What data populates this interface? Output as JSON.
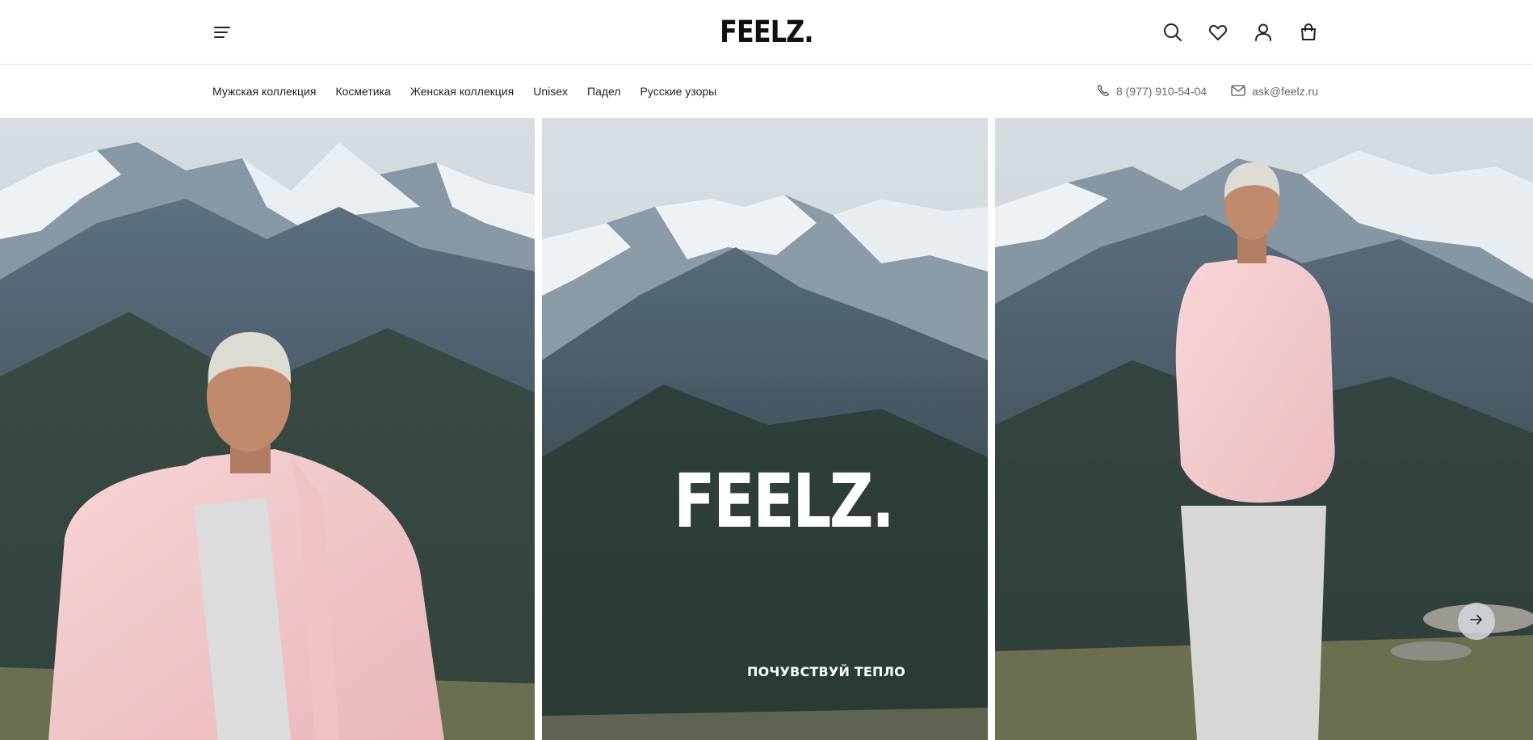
{
  "header": {
    "logo": "FEELZ.",
    "icons": [
      "menu-icon",
      "search-icon",
      "heart-icon",
      "user-icon",
      "bag-icon"
    ]
  },
  "nav": {
    "items": [
      {
        "label": "Мужская коллекция"
      },
      {
        "label": "Косметика"
      },
      {
        "label": "Женская коллекция"
      },
      {
        "label": "Unisex"
      },
      {
        "label": "Падел"
      },
      {
        "label": "Русские узоры"
      }
    ],
    "phone": "8 (977) 910-54-04",
    "email": "ask@feelz.ru"
  },
  "hero": {
    "logo": "FEELZ.",
    "tagline": "ПОЧУВСТВУЙ ТЕПЛО",
    "next_icon": "arrow-right-icon"
  },
  "colors": {
    "jacket": "#f4c9cc",
    "mountain_dark": "#3a4a55",
    "sky": "#c9d3da",
    "snow": "#eef2f5"
  }
}
